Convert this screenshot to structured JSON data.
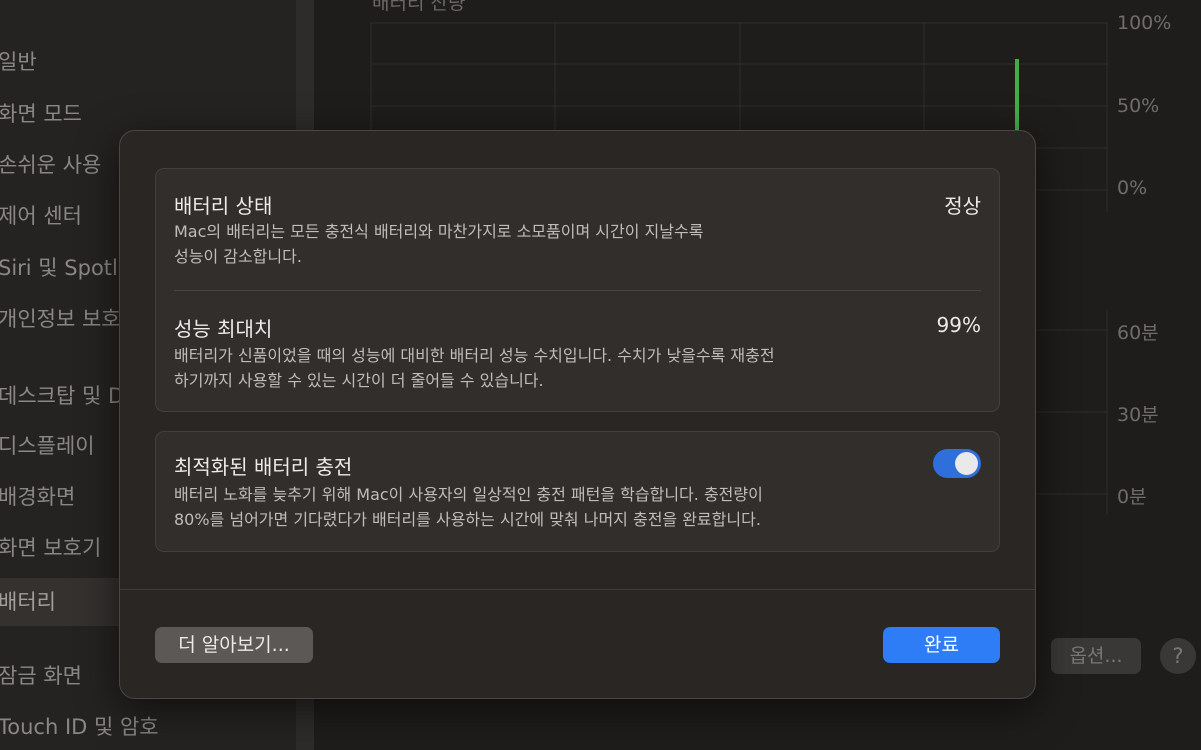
{
  "sidebar": {
    "items": [
      {
        "label": "일반"
      },
      {
        "label": "화면 모드"
      },
      {
        "label": "손쉬운 사용"
      },
      {
        "label": "제어 센터"
      },
      {
        "label": "Siri 및 Spotlight"
      },
      {
        "label": "개인정보 보호 및 보안"
      },
      {
        "label": "데스크탑 및 Dock"
      },
      {
        "label": "디스플레이"
      },
      {
        "label": "배경화면"
      },
      {
        "label": "화면 보호기"
      },
      {
        "label": "배터리"
      },
      {
        "label": "잠금 화면"
      },
      {
        "label": "Touch ID 및 암호"
      }
    ],
    "selected": "배터리"
  },
  "main": {
    "chart_title": "배터리 잔량",
    "chart1_ticks": [
      "100%",
      "50%",
      "0%"
    ],
    "chart2_ticks": [
      "60분",
      "30분",
      "0분"
    ],
    "options_label": "옵션...",
    "help_label": "?"
  },
  "dialog": {
    "battery_health": {
      "title": "배터리 상태",
      "value": "정상",
      "desc_line1": "Mac의 배터리는 모든 충전식 배터리와 마찬가지로 소모품이며 시간이 지날수록",
      "desc_line2": "성능이 감소합니다."
    },
    "max_capacity": {
      "title": "성능 최대치",
      "value": "99%",
      "desc_line1": "배터리가 신품이었을 때의 성능에 대비한 배터리 성능 수치입니다. 수치가 낮을수록 재충전",
      "desc_line2": "하기까지 사용할 수 있는 시간이 더 줄어들 수 있습니다."
    },
    "optimized_charging": {
      "title": "최적화된 배터리 충전",
      "enabled": true,
      "desc_line1": "배터리 노화를 늦추기 위해 Mac이 사용자의 일상적인 충전 패턴을 학습합니다. 충전량이",
      "desc_line2": "80%를 넘어가면 기다렸다가 배터리를 사용하는 시간에 맞춰 나머지 충전을 완료합니다."
    },
    "learn_more_label": "더 알아보기...",
    "done_label": "완료"
  },
  "colors": {
    "accent": "#2e7cf6",
    "toggle_on": "#2f6fdc",
    "chart_bar": "#3fae4a"
  }
}
